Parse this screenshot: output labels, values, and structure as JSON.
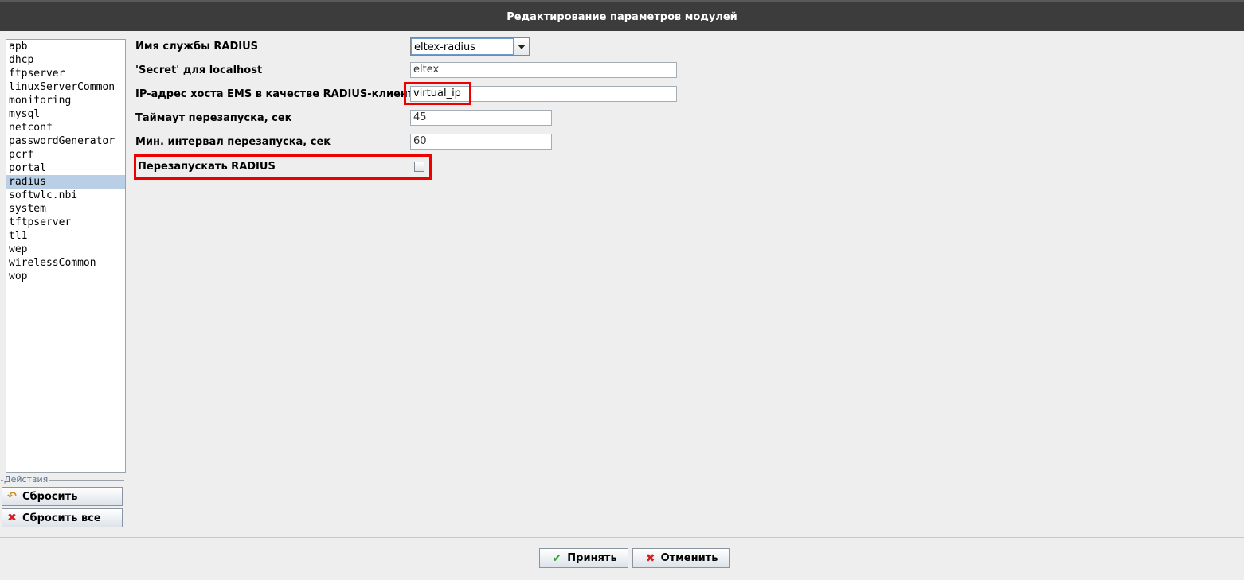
{
  "window": {
    "title": "Редактирование параметров модулей"
  },
  "modules": {
    "items": [
      "apb",
      "dhcp",
      "ftpserver",
      "linuxServerCommon",
      "monitoring",
      "mysql",
      "netconf",
      "passwordGenerator",
      "pcrf",
      "portal",
      "radius",
      "softwlc.nbi",
      "system",
      "tftpserver",
      "tl1",
      "wep",
      "wirelessCommon",
      "wop"
    ],
    "selected": "radius"
  },
  "actions": {
    "legend": "Действия",
    "reset_label": "Сбросить",
    "reset_all_label": "Сбросить все"
  },
  "form": {
    "service_name": {
      "label": "Имя службы RADIUS",
      "value": "eltex-radius"
    },
    "secret": {
      "label": "'Secret' для localhost",
      "value": "eltex"
    },
    "ems_ip": {
      "label": "IP-адрес хоста EMS в качестве RADIUS-клиента",
      "value": "virtual_ip"
    },
    "restart_timeout": {
      "label": "Таймаут перезапуска, сек",
      "value": "45"
    },
    "restart_interval": {
      "label": "Мин. интервал перезапуска, сек",
      "value": "60"
    },
    "restart_radius": {
      "label": "Перезапускать RADIUS",
      "checked": false
    }
  },
  "buttons": {
    "accept_label": "Принять",
    "cancel_label": "Отменить"
  },
  "colors": {
    "titlebar": "#3c3c3c",
    "selection": "#b8cfe5",
    "highlight": "#ee0000",
    "background": "#eeeeee"
  }
}
